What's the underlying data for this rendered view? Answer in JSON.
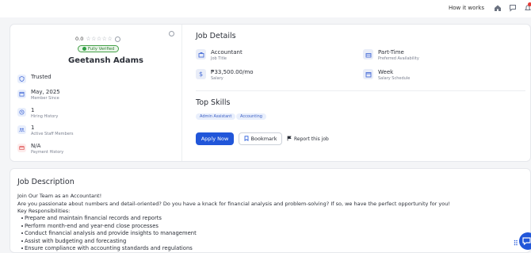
{
  "topbar": {
    "how_it_works": "How it works",
    "icons": [
      "home-icon",
      "chat-icon",
      "bell-icon"
    ]
  },
  "profile": {
    "rating": "0.0",
    "stars": "☆☆☆☆☆",
    "verified": "Fully Verified",
    "name": "Geetansh Adams",
    "stats": [
      {
        "value": "Trusted",
        "label": "",
        "icon": "shield-icon"
      },
      {
        "value": "May, 2025",
        "label": "Member Since",
        "icon": "calendar-icon"
      },
      {
        "value": "1",
        "label": "Hiring History",
        "icon": "history-icon"
      },
      {
        "value": "1",
        "label": "Active Staff Members",
        "icon": "team-icon"
      },
      {
        "value": "N/A",
        "label": "Payment History",
        "icon": "payment-icon"
      }
    ]
  },
  "job_details": {
    "title": "Job Details",
    "job_title": {
      "value": "Accountant",
      "label": "Job Title"
    },
    "availability": {
      "value": "Part-Time",
      "label": "Preferred Availability"
    },
    "salary": {
      "value": "₱33,500.00/mo",
      "label": "Salary"
    },
    "schedule": {
      "value": "Week",
      "label": "Salary Schedule"
    }
  },
  "skills": {
    "title": "Top Skills",
    "items": [
      "Admin Assistant",
      "Accounting"
    ]
  },
  "actions": {
    "apply": "Apply Now",
    "bookmark": "Bookmark",
    "report": "Report this job"
  },
  "description": {
    "title": "Job Description",
    "lines": [
      "Join Our Team as an Accountant!",
      "Are you passionate about numbers and detail-oriented? Do you have a knack for financial analysis and problem-solving? If so, we have the perfect opportunity for you!",
      "Key Responsibilities:"
    ],
    "bullets": [
      "Prepare and maintain financial records and reports",
      "Perform month-end and year-end close processes",
      "Conduct financial analysis and provide insights to management",
      "Assist with budgeting and forecasting",
      "Ensure compliance with accounting standards and regulations"
    ]
  },
  "colors": {
    "primary": "#2156d9",
    "verified": "#2e9e44",
    "alert": "#e53935"
  }
}
